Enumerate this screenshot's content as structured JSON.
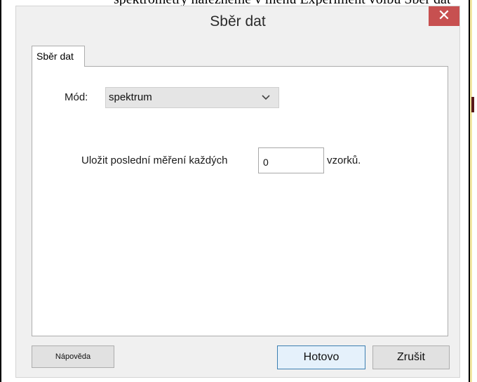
{
  "document": {
    "cut_off_text": "spektrometry nalezneme v menu Experiment volbu Sběr dat; volí se zde mód spektrum"
  },
  "dialog": {
    "title": "Sběr dat",
    "close_glyph": "✕",
    "tab_label": "Sběr dat",
    "mode": {
      "label": "Mód:",
      "selected": "spektrum"
    },
    "save_row": {
      "label": "Uložit poslední měření každých",
      "value": "0",
      "unit": "vzorků."
    },
    "buttons": {
      "help": "Nápověda",
      "done": "Hotovo",
      "cancel": "Zrušit"
    }
  },
  "colors": {
    "close_button": "#c75050",
    "dialog_background": "#f0f0f0",
    "panel_background": "#ffffff",
    "default_button_border": "#3c7fb1"
  },
  "icons": {
    "close": "close-icon",
    "dropdown": "chevron-down-icon"
  }
}
